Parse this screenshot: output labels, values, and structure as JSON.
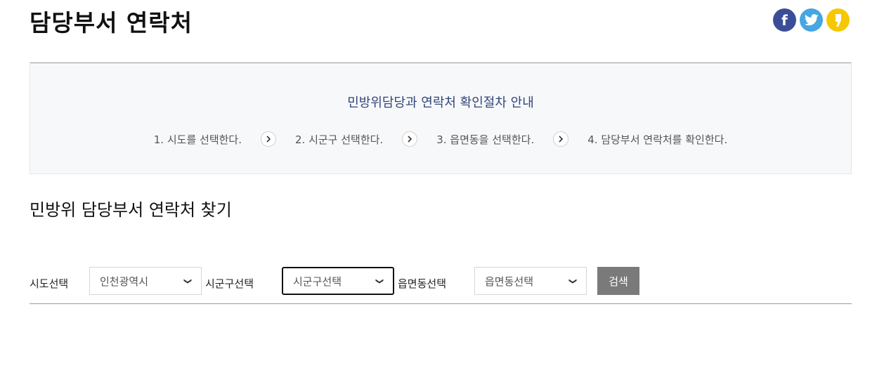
{
  "page": {
    "title": "담당부서 연락처"
  },
  "share": [
    {
      "name": "facebook",
      "icon": "facebook-icon",
      "glyph": "f",
      "color": "#3b4d96"
    },
    {
      "name": "twitter",
      "icon": "twitter-icon",
      "color": "#45a6e0"
    },
    {
      "name": "kakaostory",
      "icon": "kakaostory-icon",
      "color": "#f5c800"
    }
  ],
  "guide": {
    "title": "민방위담당과 연락처 확인절차 안내",
    "steps": [
      "1. 시도를 선택한다.",
      "2. 시군구 선택한다.",
      "3. 읍면동을 선택한다.",
      "4. 담당부서 연락처를 확인한다."
    ],
    "arrow_icon": "chevron-right-icon"
  },
  "section": {
    "title": "민방위 담당부서 연락처 찾기"
  },
  "search": {
    "sido_label": "시도선택",
    "sido_value": "인천광역시",
    "sigungu_label": "시군구선택",
    "sigungu_value": "시군구선택",
    "eupmyeondong_label": "읍면동선택",
    "eupmyeondong_value": "읍면동선택",
    "button": "검색"
  }
}
